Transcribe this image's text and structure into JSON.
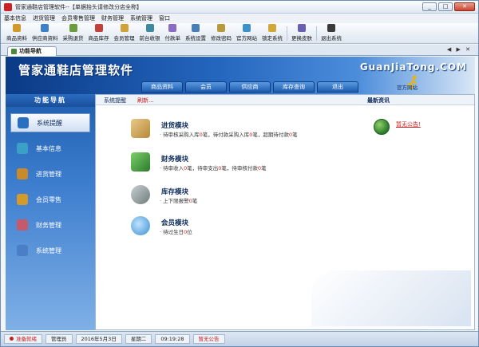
{
  "window": {
    "title": "管家通鞋店管理软件--【单据抬头请修改分店全称】"
  },
  "menu": [
    "基本信息",
    "进货管理",
    "会员零售管理",
    "财务管理",
    "系统管理",
    "窗口"
  ],
  "toolbar": [
    {
      "label": "商品资料",
      "color": "#d19a2a"
    },
    {
      "label": "供应商资料",
      "color": "#3d7fc8"
    },
    {
      "label": "采购退货",
      "color": "#6a9d3c"
    },
    {
      "label": "商品库存",
      "color": "#c4413a"
    },
    {
      "label": "会员管理",
      "color": "#d0a23a"
    },
    {
      "label": "前台收银",
      "color": "#3f8a9e"
    },
    {
      "label": "付款单",
      "color": "#8b6bc4"
    },
    {
      "label": "系统设置",
      "color": "#4a7fb5"
    },
    {
      "label": "修改密码",
      "color": "#b89a3e"
    },
    {
      "label": "官方网站",
      "color": "#3e92c9"
    },
    {
      "label": "锁定系统",
      "color": "#d1a73a"
    },
    {
      "label": "更换皮肤",
      "color": "#6b5fb3"
    },
    {
      "label": "退出系统",
      "color": "#3a3a3a"
    }
  ],
  "tab": {
    "label": "功能导航"
  },
  "banner": {
    "brand": "管家通鞋店管理软件",
    "domain": "GuanJiaTong.COM",
    "site_label": "官方网站",
    "nav": [
      "商品资料",
      "会员",
      "供应商",
      "库存查询",
      "退出"
    ]
  },
  "sidebar": {
    "title": "功能导航",
    "items": [
      {
        "label": "系统提醒",
        "color": "#2a6fc0",
        "active": true
      },
      {
        "label": "基本信息",
        "color": "#3aa0c8"
      },
      {
        "label": "进货管理",
        "color": "#c88a2a"
      },
      {
        "label": "会员零售",
        "color": "#d49a2a"
      },
      {
        "label": "财务管理",
        "color": "#c45a6a"
      },
      {
        "label": "系统管理",
        "color": "#4a7fc8"
      }
    ]
  },
  "content": {
    "tab_reminder": "系统提醒",
    "tab_refresh": "刷新...",
    "news_title": "最新资讯",
    "notice_link": "暂无公告!",
    "modules": [
      {
        "title": "进货模块",
        "color": "#c9a35a",
        "line_a": "· 待审核采购入库",
        "line_b": "笔，待付款采购入库",
        "line_c": "笔，超期待付款",
        "line_d": "笔",
        "v1": "0",
        "v2": "0",
        "v3": "0"
      },
      {
        "title": "财务模块",
        "color": "#3e9a3a",
        "line_a": "· 待审收入",
        "line_b": "笔，待审支出",
        "line_c": "笔，待审核付款",
        "line_d": "笔",
        "v1": "0",
        "v2": "0",
        "v3": "0"
      },
      {
        "title": "库存模块",
        "color": "#7a8a8a",
        "line_a": "· 上下限报警",
        "line_b": "笔",
        "v1": "0"
      },
      {
        "title": "会员模块",
        "color": "#3a8fd0",
        "line_a": "· 待过生日",
        "line_b": "位",
        "v1": "0"
      }
    ]
  },
  "status": {
    "ready": "准备就绪",
    "user": "管理员",
    "date": "2016年5月3日",
    "weekday": "星期二",
    "time": "09:19:28",
    "notice": "暂无公告"
  }
}
